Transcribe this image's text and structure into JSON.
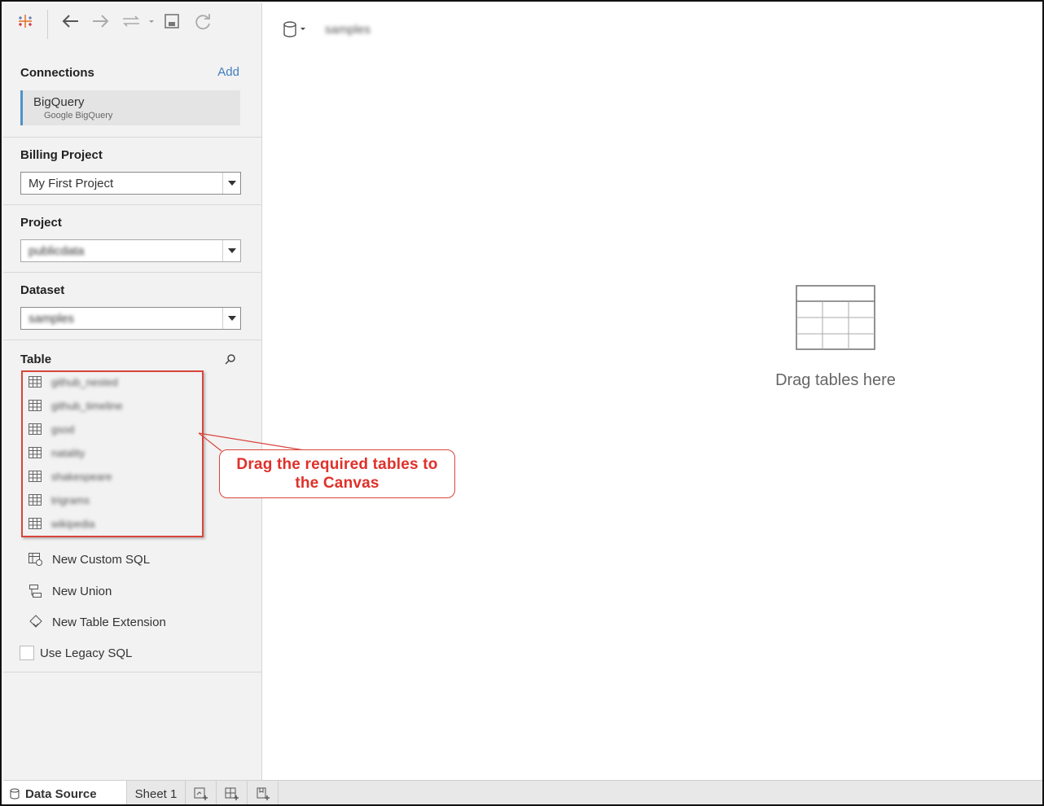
{
  "app": {
    "logo_icon": "tableau-logo-icon"
  },
  "toolbar": {
    "back_icon": "back-arrow-icon",
    "forward_icon": "forward-arrow-icon",
    "datasource_menu_icon": "redo-dropdown-icon",
    "save_icon": "save-icon",
    "refresh_icon": "refresh-icon"
  },
  "connections": {
    "title": "Connections",
    "add_label": "Add",
    "items": [
      {
        "name": "BigQuery",
        "type": "Google BigQuery"
      }
    ]
  },
  "billing_project": {
    "title": "Billing Project",
    "value": "My First Project"
  },
  "project": {
    "title": "Project",
    "value": "publicdata"
  },
  "dataset": {
    "title": "Dataset",
    "value": "samples"
  },
  "table": {
    "title": "Table",
    "items": [
      {
        "name": "github_nested"
      },
      {
        "name": "github_timeline"
      },
      {
        "name": "gsod"
      },
      {
        "name": "natality"
      },
      {
        "name": "shakespeare"
      },
      {
        "name": "trigrams"
      },
      {
        "name": "wikipedia"
      }
    ]
  },
  "actions": {
    "new_custom_sql": "New Custom SQL",
    "new_union": "New Union",
    "new_table_extension": "New Table Extension",
    "use_legacy_sql": "Use Legacy SQL"
  },
  "canvas": {
    "datasource_name": "samples",
    "drop_text": "Drag tables here"
  },
  "callout": {
    "line1": "Drag the required tables to",
    "line2": "the Canvas",
    "color": "#e0302a"
  },
  "tabs": {
    "data_source": "Data Source",
    "sheet1": "Sheet 1"
  },
  "colors": {
    "accent": "#4d93c9",
    "link": "#3f7fbf",
    "highlight": "#d9453b"
  }
}
